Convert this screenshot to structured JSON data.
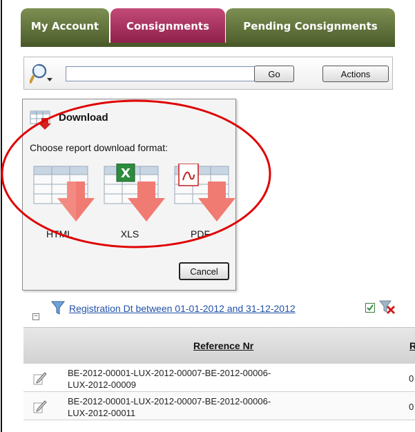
{
  "tabs": [
    {
      "label": "My Account",
      "active": false
    },
    {
      "label": "Consignments",
      "active": true
    },
    {
      "label": "Pending Consignments",
      "active": false
    }
  ],
  "colors": {
    "tab_green": "#5a6b36",
    "tab_active": "#a8305f",
    "link": "#2050a8",
    "highlight_ellipse": "#e00000"
  },
  "search": {
    "value": "",
    "go_label": "Go",
    "actions_label": "Actions",
    "icon": "search-magnifier-icon"
  },
  "download": {
    "title": "Download",
    "subtitle": "Choose report download format:",
    "formats": [
      {
        "label": "HTML",
        "icon": "html-download-icon"
      },
      {
        "label": "XLS",
        "icon": "xls-download-icon"
      },
      {
        "label": "PDF",
        "icon": "pdf-download-icon"
      }
    ],
    "cancel_label": "Cancel"
  },
  "filter": {
    "text": "Registration Dt between 01-01-2012 and 31-12-2012",
    "enabled": true
  },
  "table": {
    "columns": [
      "Reference Nr",
      "R"
    ],
    "rows": [
      {
        "ref_line1": "BE-2012-00001-LUX-2012-00007-BE-2012-00006-",
        "ref_line2": "LUX-2012-00009",
        "next_col": "0"
      },
      {
        "ref_line1": "BE-2012-00001-LUX-2012-00007-BE-2012-00006-",
        "ref_line2": "LUX-2012-00011",
        "next_col": "0"
      }
    ]
  }
}
